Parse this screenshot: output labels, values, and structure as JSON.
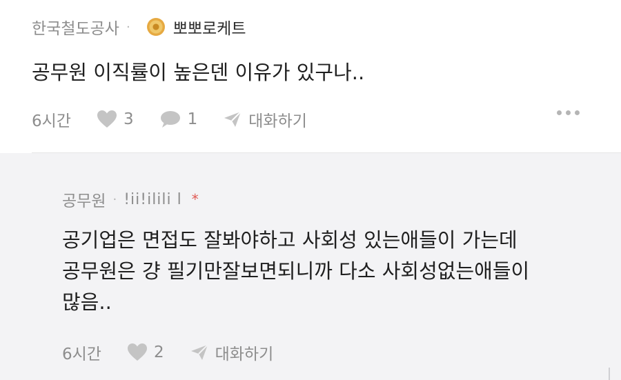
{
  "post": {
    "company": "한국철도공사",
    "separator": "·",
    "nickname": "뽀뽀로케트",
    "text": "공무원 이직률이 높은덴 이유가 있구나..",
    "time": "6시간",
    "likes": "3",
    "comments": "1",
    "chat_label": "대화하기"
  },
  "reply": {
    "company": "공무원",
    "separator": "·",
    "nickname": "!ii!ilili l",
    "author_mark": "*",
    "lines": [
      "공기업은 면접도 잘봐야하고 사회성 있는애들이 가는데",
      "공무원은 걍 필기만잘보면되니까 다소 사회성없는애들이",
      "많음.."
    ],
    "time": "6시간",
    "likes": "2",
    "chat_label": "대화하기"
  },
  "icons": {
    "heart": "heart-icon",
    "comment": "comment-icon",
    "send": "send-icon",
    "more": "more-icon",
    "badge": "rank-badge-icon"
  },
  "colors": {
    "meta_gray": "#8d8d8d",
    "reply_bg": "#f3f3f5",
    "author_mark": "#e05a54"
  }
}
